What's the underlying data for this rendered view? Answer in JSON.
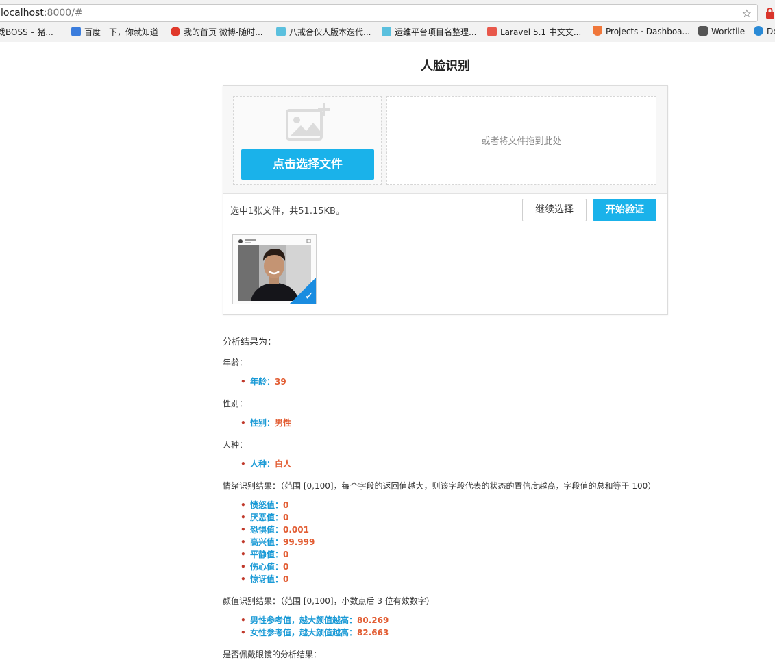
{
  "browser": {
    "url_host": "localhost",
    "url_rest": ":8000/#",
    "bookmarks": [
      {
        "label": "戏BOSS – 猪...",
        "color": "#888888"
      },
      {
        "label": "百度一下，你就知道",
        "color": "#3b7ddd"
      },
      {
        "label": "我的首页 微博-随时...",
        "color": "#e0392b"
      },
      {
        "label": "八戒合伙人版本迭代...",
        "color": "#5bc0de"
      },
      {
        "label": "运维平台项目名整理...",
        "color": "#5bc0de"
      },
      {
        "label": "Laravel 5.1 中文文...",
        "color": "#e8584b"
      },
      {
        "label": "Projects · Dashboa...",
        "color": "#f0773a"
      },
      {
        "label": "Worktile",
        "color": "#555555"
      },
      {
        "label": "Do",
        "color": "#2a8ad6"
      }
    ]
  },
  "page": {
    "title": "人脸识别"
  },
  "uploader": {
    "pick_label": "点击选择文件",
    "drop_text": "或者将文件拖到此处",
    "status": "选中1张文件，共51.15KB。",
    "continue_label": "继续选择",
    "start_label": "开始验证"
  },
  "results": {
    "heading": "分析结果为：",
    "age": {
      "title": "年龄：",
      "key": "年龄：",
      "value": "39"
    },
    "gender": {
      "title": "性别：",
      "key": "性别：",
      "value": "男性"
    },
    "race": {
      "title": "人种：",
      "key": "人种：",
      "value": "白人"
    },
    "emotion": {
      "title": "情绪识别结果：（范围 [0,100]，每个字段的返回值越大，则该字段代表的状态的置信度越高，字段值的总和等于 100）",
      "items": [
        {
          "key": "愤怒值：",
          "value": "0"
        },
        {
          "key": "厌恶值：",
          "value": "0"
        },
        {
          "key": "恐惧值：",
          "value": "0.001"
        },
        {
          "key": "高兴值：",
          "value": "99.999"
        },
        {
          "key": "平静值：",
          "value": "0"
        },
        {
          "key": "伤心值：",
          "value": "0"
        },
        {
          "key": "惊讶值：",
          "value": "0"
        }
      ]
    },
    "beauty": {
      "title": "颜值识别结果：（范围 [0,100]，小数点后 3 位有效数字）",
      "items": [
        {
          "key": "男性参考值，越大颜值越高：",
          "value": "80.269"
        },
        {
          "key": "女性参考值，越大颜值越高：",
          "value": "82.663"
        }
      ]
    },
    "glasses_title": "是否佩戴眼镜的分析结果："
  }
}
